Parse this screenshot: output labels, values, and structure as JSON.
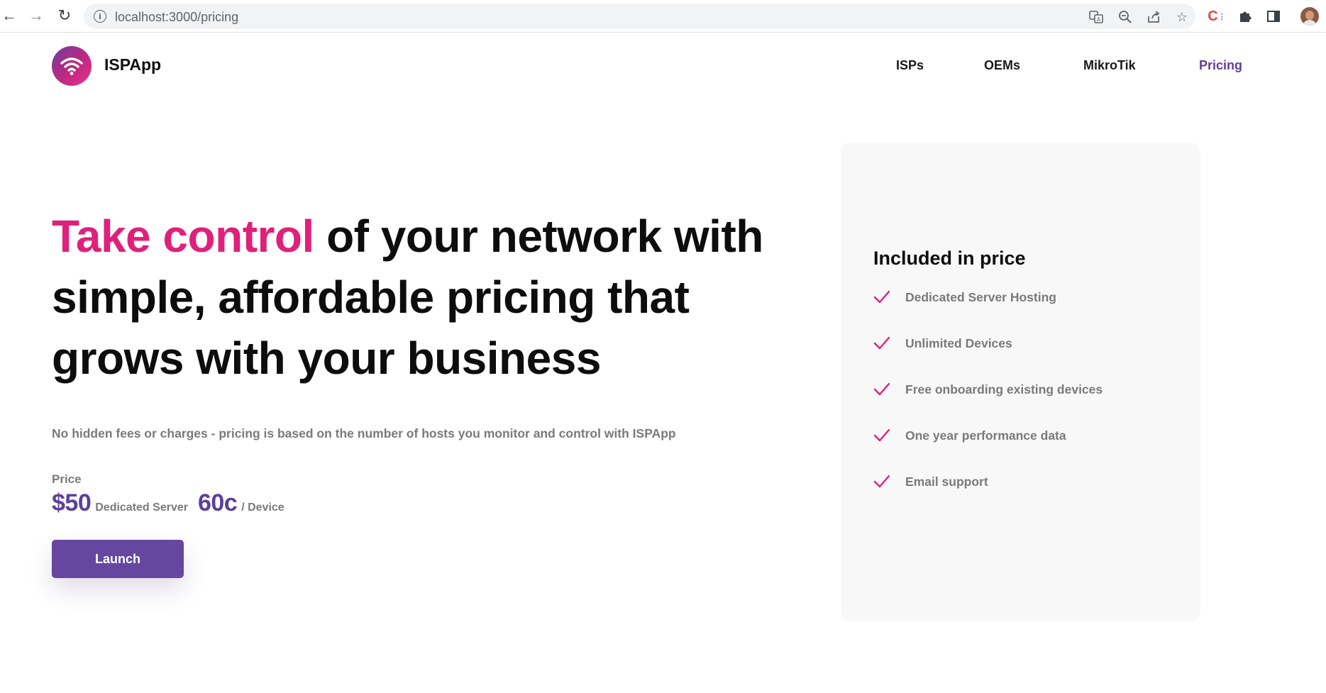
{
  "browser": {
    "url": "localhost:3000/pricing",
    "extension_label": "C"
  },
  "site": {
    "brand": "ISPApp",
    "nav": [
      "ISPs",
      "OEMs",
      "MikroTik",
      "Pricing"
    ],
    "active_nav": "Pricing"
  },
  "hero": {
    "title_accent": "Take control",
    "title_rest": " of your network with simple, affordable pricing that grows with your business",
    "subtitle": "No hidden fees or charges - pricing is based on the number of hosts you monitor and control with ISPApp",
    "price_label": "Price",
    "server_price": "$50",
    "server_price_desc": "Dedicated Server",
    "device_price": "60c",
    "device_price_desc": "/ Device",
    "launch_label": "Launch"
  },
  "included": {
    "title": "Included in price",
    "items": [
      "Dedicated Server Hosting",
      "Unlimited Devices",
      "Free onboarding existing devices",
      "One year performance data",
      "Email support"
    ]
  },
  "colors": {
    "accent_pink": "#e0207a",
    "accent_purple": "#5d3f9a",
    "button_purple": "#66479f",
    "muted_text": "#7a7a7a",
    "card_bg": "#f8f8f8"
  }
}
